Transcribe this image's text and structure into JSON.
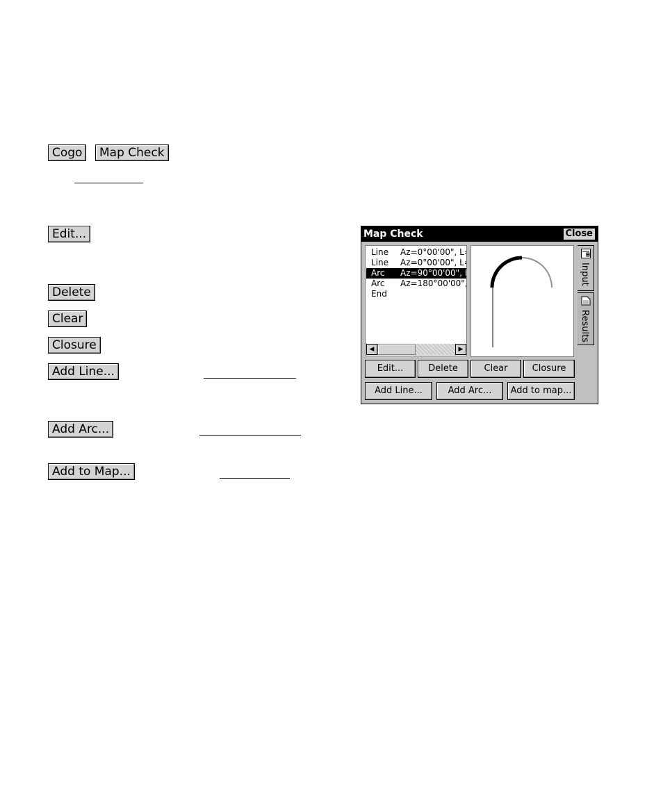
{
  "doc": {
    "cogo_label": "Cogo",
    "mapcheck_label": "Map Check",
    "edit_label": "Edit...",
    "delete_label": "Delete",
    "clear_label": "Clear",
    "closure_label": "Closure",
    "addline_label": "Add Line...",
    "addarc_label": "Add Arc...",
    "addtomap_label": "Add to Map..."
  },
  "dialog": {
    "title": "Map Check",
    "close_label": "Close",
    "list": [
      {
        "type": "Line",
        "desc": "Az=0°00'00\", L=",
        "selected": false
      },
      {
        "type": "Line",
        "desc": "Az=0°00'00\", L=",
        "selected": false
      },
      {
        "type": "Arc",
        "desc": "Az=90°00'00\", R",
        "selected": true
      },
      {
        "type": "Arc",
        "desc": "Az=180°00'00\",",
        "selected": false
      },
      {
        "type": "End",
        "desc": "",
        "selected": false
      }
    ],
    "buttons_row1": [
      "Edit...",
      "Delete",
      "Clear",
      "Closure"
    ],
    "buttons_row2": [
      "Add Line...",
      "Add Arc...",
      "Add to map..."
    ],
    "tabs": [
      "Input",
      "Results"
    ],
    "icons": {
      "scroll_left": "left-arrow-icon",
      "scroll_right": "right-arrow-icon",
      "input_tab": "form-icon",
      "results_tab": "document-icon"
    }
  }
}
